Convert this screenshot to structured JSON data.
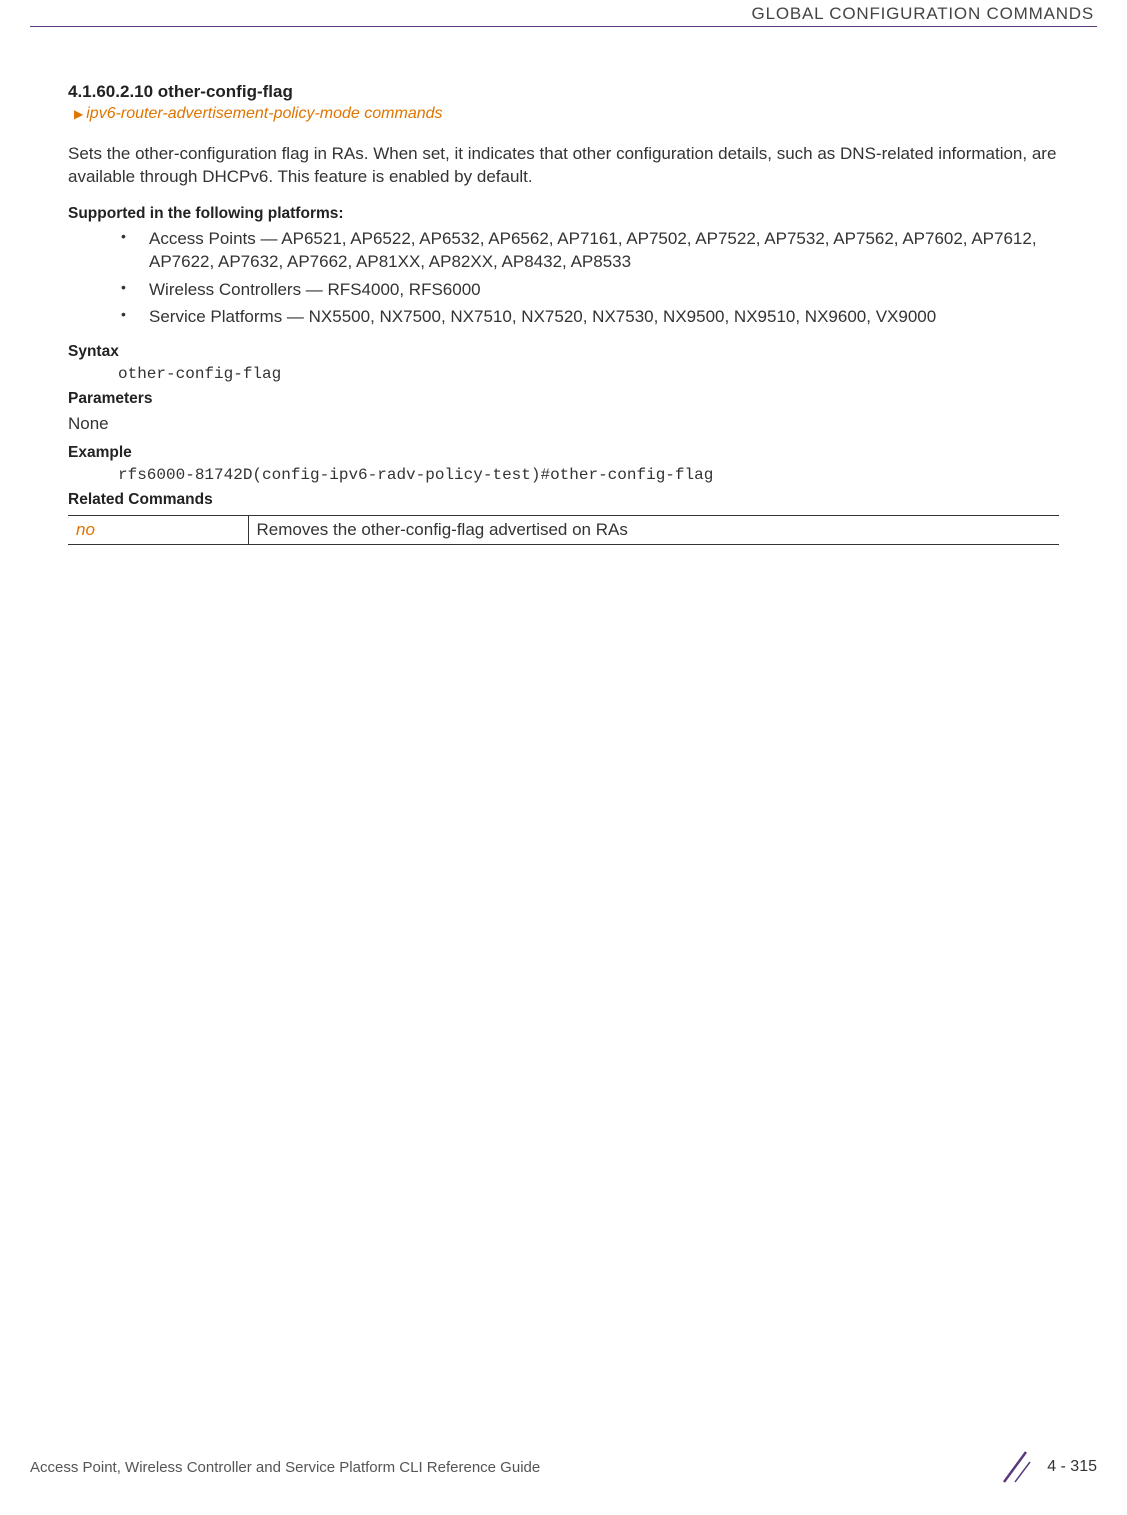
{
  "header": {
    "title": "GLOBAL CONFIGURATION COMMANDS"
  },
  "section": {
    "number": "4.1.60.2.10 other-config-flag",
    "breadcrumb": "ipv6-router-advertisement-policy-mode commands",
    "description": "Sets the other-configuration flag in RAs. When set, it indicates that other configuration details, such as DNS-related information, are available through DHCPv6. This feature is enabled by default."
  },
  "supported": {
    "heading": "Supported in the following platforms:",
    "items": [
      "Access Points — AP6521, AP6522, AP6532, AP6562, AP7161, AP7502, AP7522, AP7532, AP7562, AP7602, AP7612, AP7622, AP7632, AP7662, AP81XX, AP82XX, AP8432, AP8533",
      "Wireless Controllers — RFS4000, RFS6000",
      "Service Platforms — NX5500, NX7500, NX7510, NX7520, NX7530, NX9500, NX9510, NX9600, VX9000"
    ]
  },
  "syntax": {
    "heading": "Syntax",
    "value": "other-config-flag"
  },
  "parameters": {
    "heading": "Parameters",
    "value": "None"
  },
  "example": {
    "heading": "Example",
    "value": "rfs6000-81742D(config-ipv6-radv-policy-test)#other-config-flag"
  },
  "related": {
    "heading": "Related Commands",
    "rows": [
      {
        "cmd": "no",
        "desc": "Removes the other-config-flag advertised on RAs"
      }
    ]
  },
  "footer": {
    "text": "Access Point, Wireless Controller and Service Platform CLI Reference Guide",
    "page": "4 - 315"
  }
}
